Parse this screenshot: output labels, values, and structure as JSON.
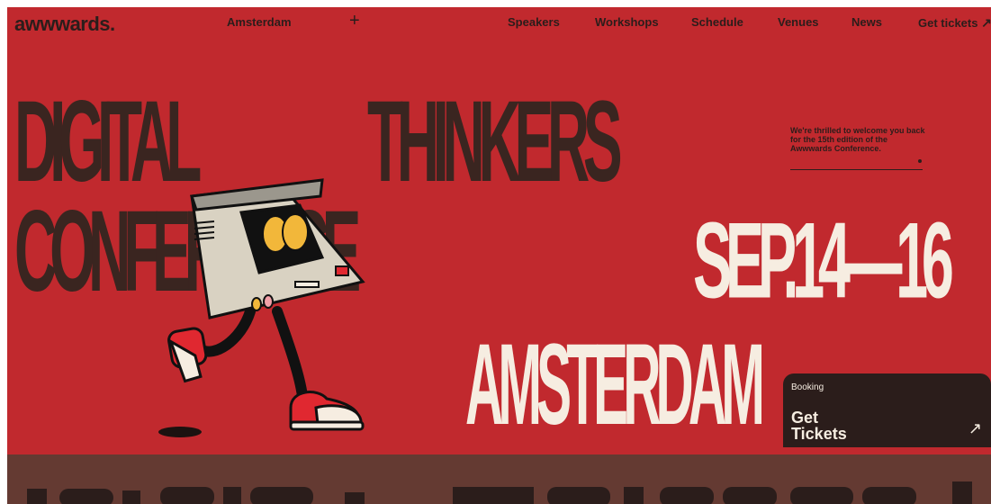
{
  "nav": {
    "logo": "awwwards.",
    "city": "Amsterdam",
    "plus": "+",
    "links": [
      "Speakers",
      "Workshops",
      "Schedule",
      "Venues",
      "News"
    ],
    "get_tickets": "Get tickets",
    "get_tickets_arrow": "↗"
  },
  "hero": {
    "line1a": "DIGITAL",
    "line1b": "THINKERS",
    "line2": "CONFERENCE",
    "date": "SEP.14—16",
    "city": "AMSTERDAM",
    "intro": "We're thrilled to welcome you back for the 15th edition of the Awwwards Conference."
  },
  "booking": {
    "label": "Booking",
    "cta_line1": "Get",
    "cta_line2": "Tickets",
    "arrow": "↗"
  },
  "colors": {
    "background": "#c1292e",
    "dark": "#2b1d1b",
    "cream": "#f6ede1",
    "band": "#643a32"
  }
}
